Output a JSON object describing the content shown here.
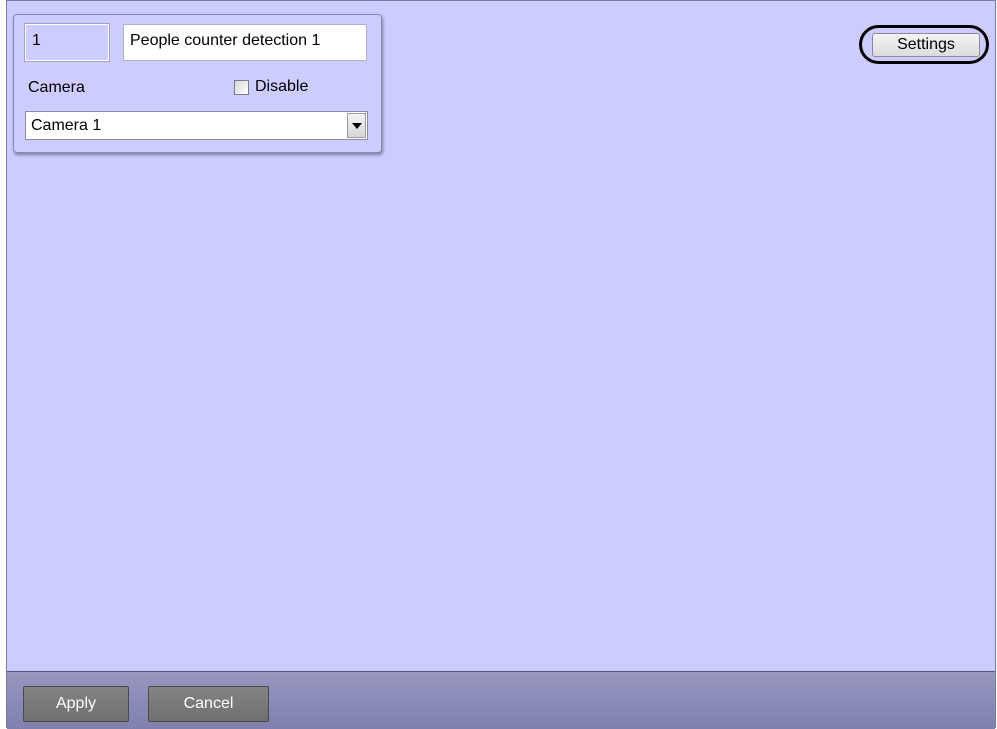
{
  "object_panel": {
    "id_value": "1",
    "name_value": "People counter detection 1",
    "camera_label": "Camera",
    "disable_label": "Disable",
    "disable_checked": false,
    "camera_selected": "Camera 1"
  },
  "toolbar": {
    "settings_label": "Settings"
  },
  "footer": {
    "apply_label": "Apply",
    "cancel_label": "Cancel"
  },
  "colors": {
    "panel_background": "#ccccff",
    "footer_background": "#8a8ab6",
    "button_gray": "#7a7a7a"
  },
  "icons": {
    "dropdown": "chevron-down-icon",
    "checkbox": "checkbox-unchecked-icon"
  }
}
